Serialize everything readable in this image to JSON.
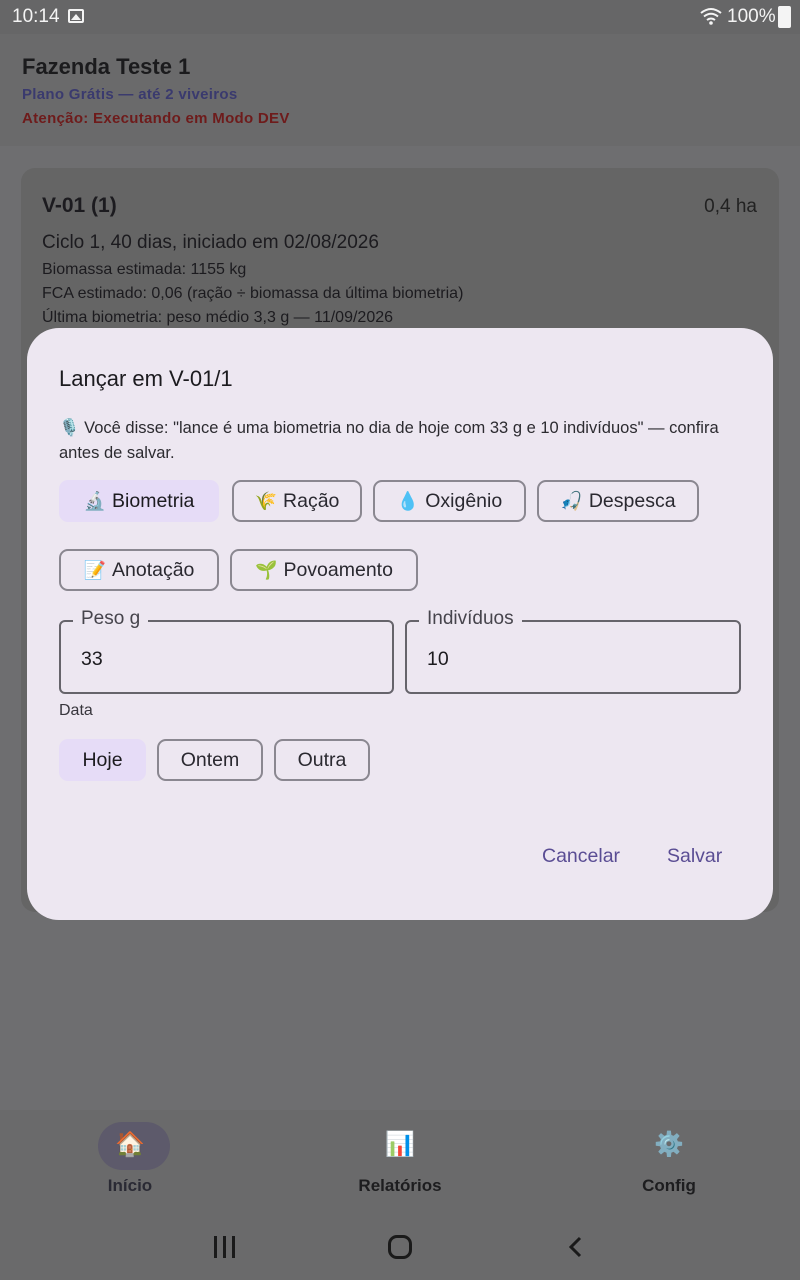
{
  "status_bar": {
    "time": "10:14",
    "battery": "100%"
  },
  "header": {
    "farm_name": "Fazenda Teste 1",
    "plan": "Plano Grátis — até 2 viveiros",
    "dev_warning": "Atenção: Executando em Modo DEV"
  },
  "pond": {
    "title": "V-01 (1)",
    "area": "0,4 ha",
    "cycle": "Ciclo 1, 40 dias, iniciado em 02/08/2026",
    "biomass": "Biomassa estimada: 1155 kg",
    "fca": "FCA estimado: 0,06 (ração ÷ biomassa da última biometria)",
    "last_biometry": "Última biometria: peso médio 3,3 g — 11/09/2026"
  },
  "dialog": {
    "title": "Lançar em V-01/1",
    "voice_text": "🎙️ Você disse: \"lance é uma biometria no dia de hoje com 33 g e 10 indivíduos\" — confira antes de salvar.",
    "types": [
      {
        "emoji": "🔬",
        "label": "Biometria",
        "selected": true
      },
      {
        "emoji": "🌾",
        "label": "Ração"
      },
      {
        "emoji": "💧",
        "label": "Oxigênio"
      },
      {
        "emoji": "🎣",
        "label": "Despesca"
      },
      {
        "emoji": "📝",
        "label": "Anotação"
      },
      {
        "emoji": "🌱",
        "label": "Povoamento"
      }
    ],
    "weight_field": {
      "label": "Peso g",
      "value": "33"
    },
    "count_field": {
      "label": "Indivíduos",
      "value": "10"
    },
    "date_label": "Data",
    "date_options": [
      {
        "label": "Hoje",
        "selected": true
      },
      {
        "label": "Ontem"
      },
      {
        "label": "Outra"
      }
    ],
    "cancel": "Cancelar",
    "save": "Salvar"
  },
  "bottom_nav": [
    {
      "icon": "🏠",
      "label": "Início",
      "active": true
    },
    {
      "icon": "📊",
      "label": "Relatórios"
    },
    {
      "icon": "⚙️",
      "label": "Config"
    }
  ],
  "colors": {
    "accent": "#5a4d94",
    "selected_chip": "#e6dcf7",
    "dialog_bg": "#ede7f1",
    "scrim": "#6e6e70"
  }
}
